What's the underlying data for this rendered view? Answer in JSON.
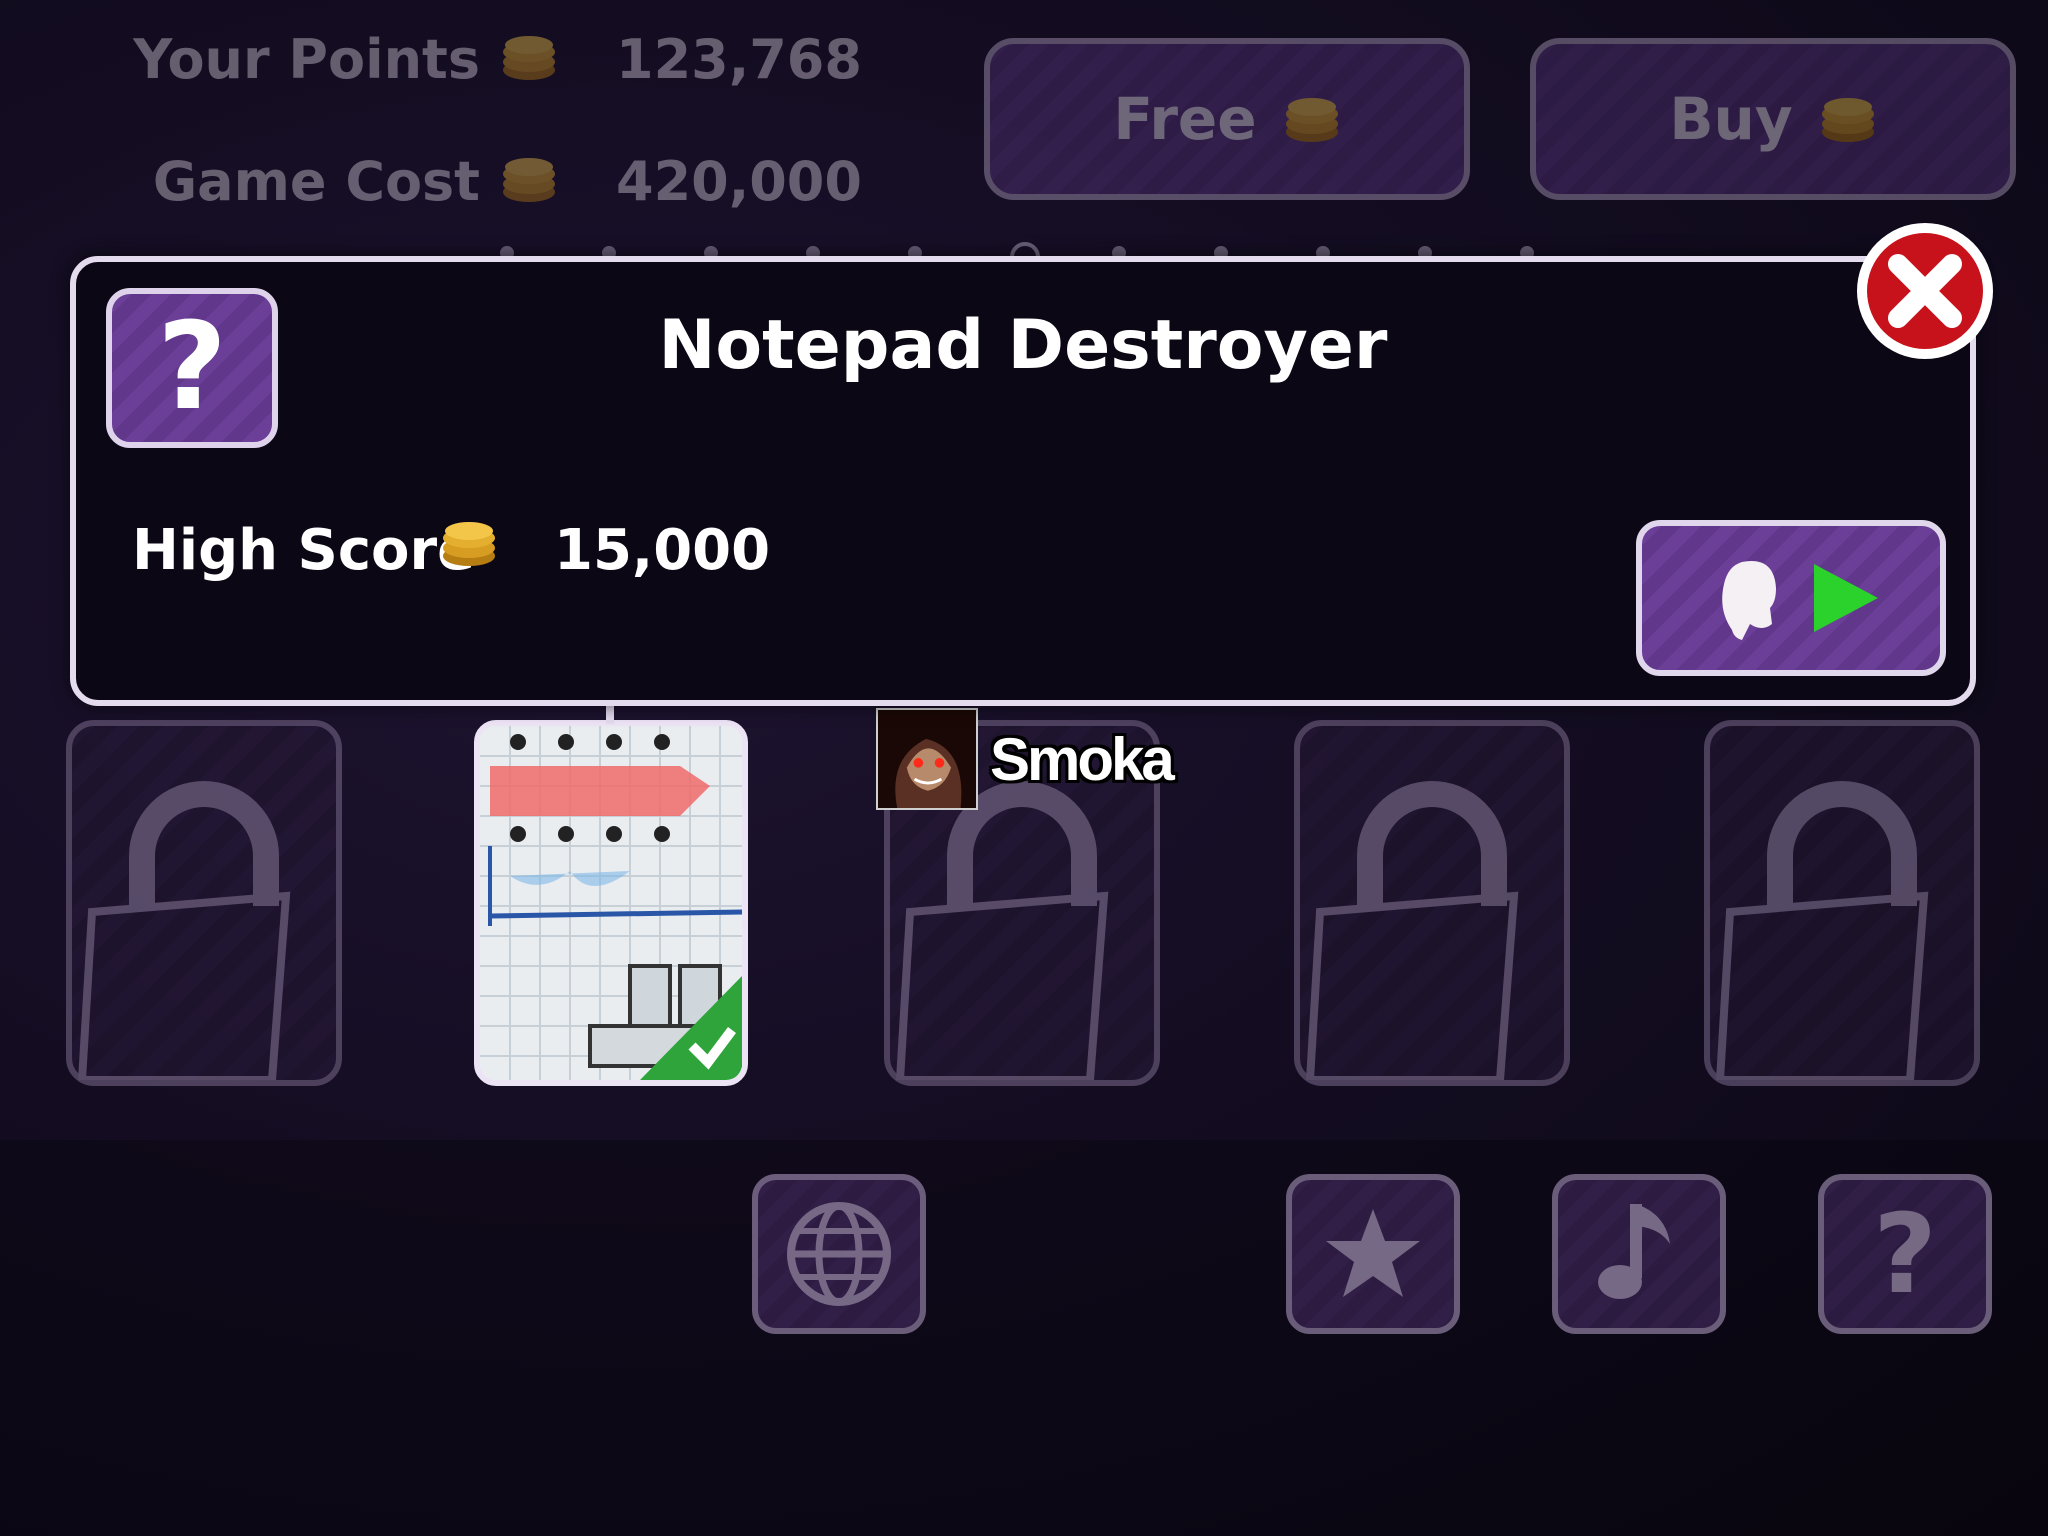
{
  "hud": {
    "points_label": "Your Points",
    "points_value": "123,768",
    "cost_label": "Game Cost",
    "cost_value": "420,000",
    "free_label": "Free",
    "buy_label": "Buy"
  },
  "pager": {
    "count": 11,
    "active_index": 5
  },
  "panel": {
    "title": "Notepad Destroyer",
    "help_symbol": "?",
    "high_score_label": "High Score",
    "high_score_value": "15,000"
  },
  "slots": [
    {
      "state": "locked"
    },
    {
      "state": "unlocked",
      "completed": true
    },
    {
      "state": "locked"
    },
    {
      "state": "locked"
    },
    {
      "state": "locked"
    }
  ],
  "user": {
    "name": "Smoka"
  },
  "toolbar": {
    "icons": [
      "globe-icon",
      "star-icon",
      "music-note-icon",
      "help-icon"
    ],
    "help_symbol": "?"
  },
  "colors": {
    "accent_purple": "#6b3f98",
    "play_green": "#2bd22b",
    "close_red": "#c8121b",
    "coin_gold": "#e0a92a",
    "check_green": "#2ea43a"
  }
}
